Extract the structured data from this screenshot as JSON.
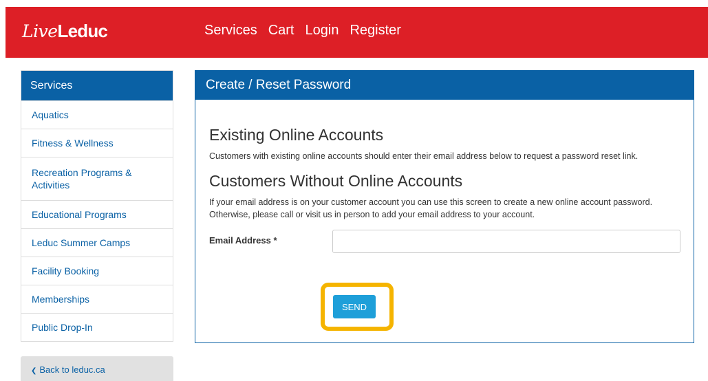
{
  "brand": {
    "script": "Live",
    "bold": "Leduc",
    "color": "#dd1f26"
  },
  "nav": [
    "Services",
    "Cart",
    "Login",
    "Register"
  ],
  "sidebar": {
    "title": "Services",
    "items": [
      "Aquatics",
      "Fitness & Wellness",
      "Recreation Programs & Activities",
      "Educational Programs",
      "Leduc Summer Camps",
      "Facility Booking",
      "Memberships",
      "Public Drop-In"
    ]
  },
  "back_link": {
    "icon": "chevron-left-icon",
    "label": "Back to leduc.ca"
  },
  "panel": {
    "title": "Create / Reset Password",
    "sections": [
      {
        "heading": "Existing Online Accounts",
        "text": "Customers with existing online accounts should enter their email address below to request a password reset link."
      },
      {
        "heading": "Customers Without Online Accounts",
        "text": "If your email address is on your customer account you can use this screen to create a new online account password. Otherwise, please call or visit us in person to add your email address to your account."
      }
    ],
    "email_label": "Email Address",
    "required_marker": "*",
    "email_value": "",
    "send_label": "SEND"
  },
  "colors": {
    "primary": "#0a61a5",
    "button": "#1e9fd9",
    "highlight": "#f5b400"
  }
}
